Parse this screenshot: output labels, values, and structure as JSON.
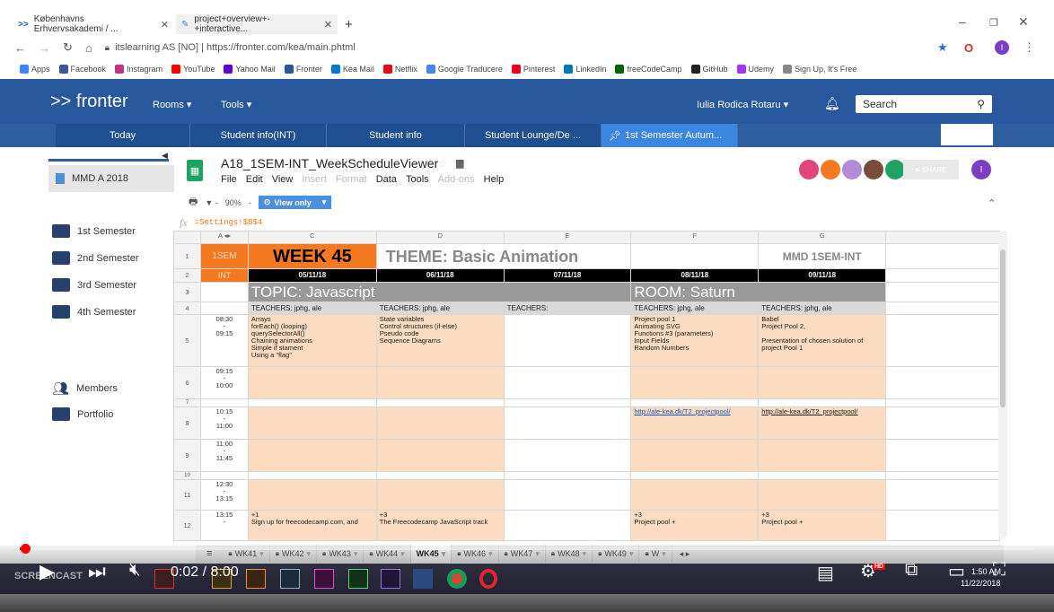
{
  "browser": {
    "tabs": [
      {
        "title": "Københavns Erhvervsakademi / ..."
      },
      {
        "title": "project+overview+-+interactive..."
      }
    ],
    "address": "itslearning AS [NO]  |  https://fronter.com/kea/main.phtml",
    "bookmarks": [
      {
        "label": "Apps",
        "color": "#4285f4"
      },
      {
        "label": "Facebook",
        "color": "#3b5998"
      },
      {
        "label": "Instagram",
        "color": "#c13584"
      },
      {
        "label": "YouTube",
        "color": "#ff0000"
      },
      {
        "label": "Yahoo Mail",
        "color": "#6001d2"
      },
      {
        "label": "Fronter",
        "color": "#27589e"
      },
      {
        "label": "Kea Mail",
        "color": "#0078d4"
      },
      {
        "label": "Netflix",
        "color": "#e50914"
      },
      {
        "label": "Google Traducere",
        "color": "#4285f4"
      },
      {
        "label": "Pinterest",
        "color": "#e60023"
      },
      {
        "label": "LinkedIn",
        "color": "#0077b5"
      },
      {
        "label": "freeCodeCamp",
        "color": "#006400"
      },
      {
        "label": "GitHub",
        "color": "#222222"
      },
      {
        "label": "Udemy",
        "color": "#a435f0"
      },
      {
        "label": "Sign Up, It's Free",
        "color": "#888888"
      }
    ]
  },
  "fronter": {
    "logo": ">> fronter",
    "rooms": "Rooms",
    "tools": "Tools",
    "user": "Iulia Rodica Rotaru",
    "search_label": "Search",
    "nav": [
      "Today",
      "Student info(INT)",
      "Student info",
      "Student Lounge/De ...",
      "1st Semester Autum..."
    ],
    "room": "MMD A 2018",
    "semesters": [
      "1st Semester",
      "2nd Semester",
      "3rd Semester",
      "4th Semester"
    ],
    "members": "Members",
    "portfolio": "Portfolio"
  },
  "sheet": {
    "title": "A18_1SEM-INT_WeekScheduleViewer",
    "menu": [
      "File",
      "Edit",
      "View",
      "Insert",
      "Format",
      "Data",
      "Tools",
      "Add-ons",
      "Help"
    ],
    "menu_disabled": [
      "Insert",
      "Format",
      "Add-ons"
    ],
    "zoom": "90%",
    "view_only": "View only",
    "share": "SHARE",
    "formula": "=Settings!$B$4",
    "col_letters": [
      "A",
      "C",
      "D",
      "E",
      "F",
      "G"
    ],
    "row_numbers": [
      "1",
      "2",
      "3",
      "4",
      "5",
      "6",
      "7",
      "8",
      "9",
      "10",
      "11",
      "12"
    ],
    "r1_a": "1SEM",
    "r2_a": "INT",
    "week": "WEEK 45",
    "theme": "THEME: Basic Animation",
    "code": "MMD 1SEM-INT",
    "dates": [
      "05/11/18",
      "06/11/18",
      "07/11/18",
      "08/11/18",
      "09/11/18"
    ],
    "topic": "TOPIC: Javascript",
    "room": "ROOM: Saturn",
    "teachers": [
      "TEACHERS: jphg, ale",
      "TEACHERS: jphg, ale",
      "TEACHERS:",
      "TEACHERS: jphg, ale",
      "TEACHERS: jphg, ale"
    ],
    "times": {
      "r5": [
        "08:30",
        "-",
        "09:15"
      ],
      "r6": [
        "09:15",
        "-",
        "10:00"
      ],
      "r8": [
        "10:15",
        "-",
        "11:00"
      ],
      "r9": [
        "11:00",
        "-",
        "11:45"
      ],
      "r11": [
        "12:30",
        "-",
        "13:15"
      ],
      "r12": [
        "13:15",
        "-"
      ]
    },
    "r5_c": "Arrays\n forEach() (looping)\nquerySelectorAll()\nChaining animations\nSimple if stament\nUsing a \"flag\"",
    "r5_d": "State variables\nControl structures (if-else)\nPseudo code\nSequence Diagrams",
    "r5_f": "Project pool 1\nAnimating SVG\nFunctions #3 (parameters)\nInput Fields\nRandom Numbers",
    "r5_g": "Babel\nProject Pool 2,\n\nPresentation of chosen solution of\nproject Pool 1",
    "r8_f": "http://ale-kea.dk/T2_projectpool/",
    "r8_g": "http://ale-kea.dk/T2_projectpool/",
    "r12_c": "+1\nSign up for freecodecamp.com, and",
    "r12_d": "+3\nThe Freecodecamp JavaScript track",
    "r12_f": "+3\nProject pool +",
    "r12_g": "+3\nProject pool +",
    "tabs": [
      "WK41",
      "WK42",
      "WK43",
      "WK44",
      "WK45",
      "WK46",
      "WK47",
      "WK48",
      "WK49",
      "W"
    ],
    "active_tab": "WK45"
  },
  "video": {
    "time": "0:02 / 8:00",
    "progress": 0.004,
    "watermark": "SCREENCAST",
    "clock": "1:50 AM",
    "date": "11/22/2018"
  },
  "colors": {
    "fronter_blue": "#27589e",
    "orange": "#f47920",
    "peach": "#fbdcc0",
    "accent_green": "#1ea362"
  }
}
